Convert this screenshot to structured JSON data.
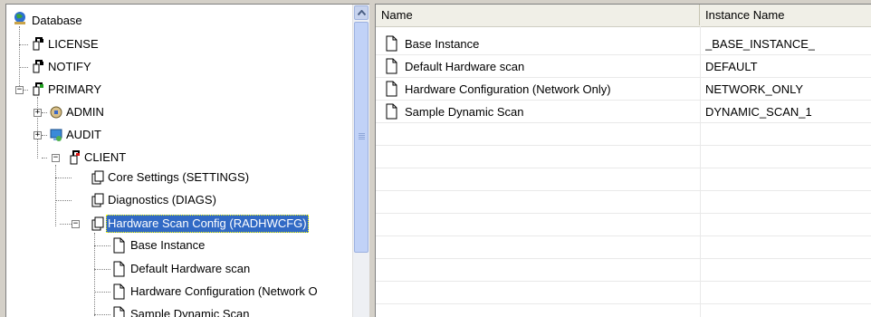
{
  "tree": {
    "items": [
      {
        "label": "Database",
        "icon": "database-icon",
        "expander": ""
      },
      {
        "label": "LICENSE",
        "icon": "domain-icon",
        "expander": ""
      },
      {
        "label": "NOTIFY",
        "icon": "domain-icon",
        "expander": ""
      },
      {
        "label": "PRIMARY",
        "icon": "domain-icon",
        "expander": "−"
      },
      {
        "label": "ADMIN",
        "icon": "admin-domain-icon",
        "expander": "+"
      },
      {
        "label": "AUDIT",
        "icon": "audit-domain-icon",
        "expander": "+"
      },
      {
        "label": "CLIENT",
        "icon": "client-domain-icon",
        "expander": "−"
      },
      {
        "label": "Core Settings (SETTINGS)",
        "icon": "class-icon",
        "expander": ""
      },
      {
        "label": "Diagnostics (DIAGS)",
        "icon": "class-icon",
        "expander": ""
      },
      {
        "label": "Hardware Scan Config (RADHWCFG)",
        "icon": "class-icon",
        "expander": "−"
      },
      {
        "label": "Base Instance",
        "icon": "instance-icon",
        "expander": ""
      },
      {
        "label": "Default Hardware scan",
        "icon": "instance-icon",
        "expander": ""
      },
      {
        "label": "Hardware Configuration (Network O",
        "icon": "instance-icon",
        "expander": ""
      },
      {
        "label": "Sample Dynamic Scan",
        "icon": "instance-icon",
        "expander": ""
      }
    ],
    "selected_label": "Hardware Scan Config (RADHWCFG)"
  },
  "list": {
    "columns": [
      "Name",
      "Instance Name"
    ],
    "rows": [
      {
        "name": "Base Instance",
        "instance_name": "_BASE_INSTANCE_",
        "icon": "instance-icon"
      },
      {
        "name": "Default Hardware scan",
        "instance_name": "DEFAULT",
        "icon": "instance-icon"
      },
      {
        "name": "Hardware Configuration (Network Only)",
        "instance_name": "NETWORK_ONLY",
        "icon": "instance-icon"
      },
      {
        "name": "Sample Dynamic Scan",
        "instance_name": "DYNAMIC_SCAN_1",
        "icon": "instance-icon"
      }
    ]
  },
  "colors": {
    "selection": "#316ac5",
    "scrollbar_thumb": "#c1d2f7"
  }
}
